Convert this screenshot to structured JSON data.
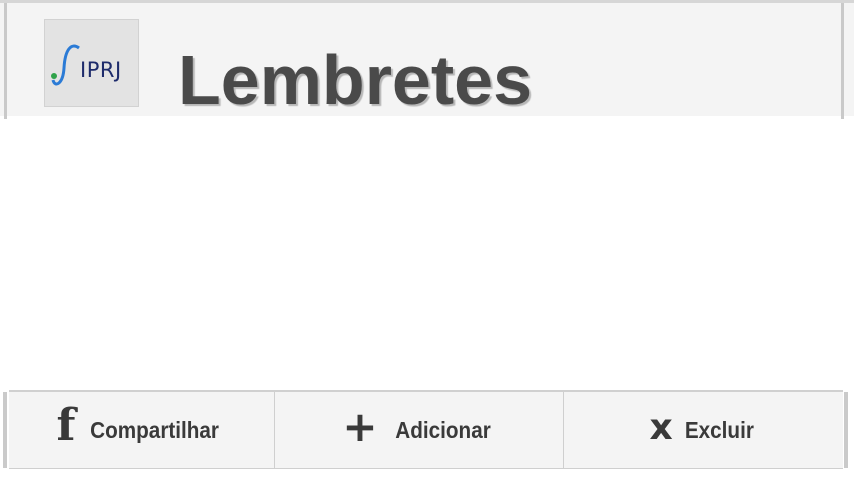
{
  "header": {
    "logo_text": "IPRJ",
    "logo_icon": "integral-wave-icon",
    "title": "Lembretes"
  },
  "footer": {
    "buttons": [
      {
        "icon": "f",
        "icon_name": "facebook-icon",
        "label": "Compartilhar"
      },
      {
        "icon": "+",
        "icon_name": "plus-icon",
        "label": "Adicionar"
      },
      {
        "icon": "x",
        "icon_name": "close-icon",
        "label": "Excluir"
      }
    ]
  },
  "colors": {
    "header_bg": "#f4f4f4",
    "title": "#4a4a4a",
    "button_text": "#3a3a3a",
    "logo_blue": "#1d2b6b"
  }
}
